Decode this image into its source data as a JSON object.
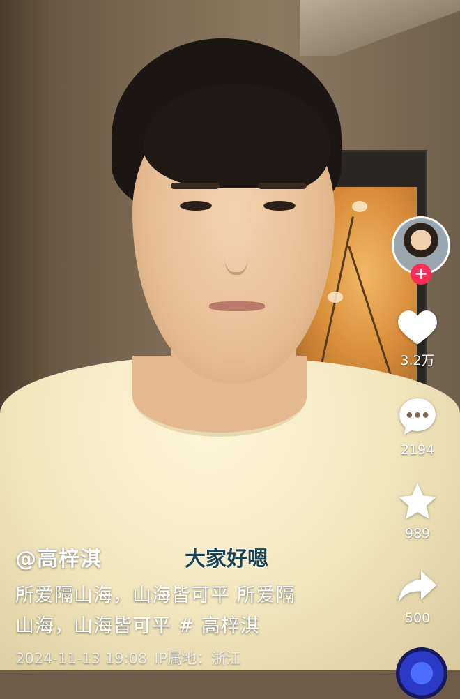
{
  "author": {
    "handle": "@高梓淇"
  },
  "overlay_text": "大家好嗯",
  "caption": {
    "line1": "所爱隔山海，山海皆可平 所爱隔",
    "line2": "山海，山海皆可平 # 高梓淇"
  },
  "meta": {
    "timestamp": "2024-11-13 19:08",
    "ip_label": "IP属地：",
    "location": "浙江"
  },
  "actions": {
    "follow_symbol": "+",
    "like_count": "3.2万",
    "comment_count": "2194",
    "favorite_count": "989",
    "share_count": "500"
  },
  "colors": {
    "follow_badge": "#fe2c55",
    "overlay_text": "#1e4350"
  },
  "icons": [
    "heart-icon",
    "comment-icon",
    "star-icon",
    "share-icon",
    "plus-icon",
    "music-disc-icon"
  ]
}
